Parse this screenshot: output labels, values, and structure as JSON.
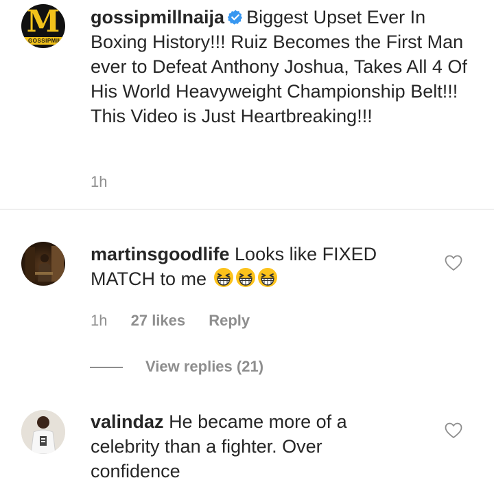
{
  "post": {
    "username": "gossipmillnaija",
    "avatar_text": "M",
    "avatar_band_text": "GOSSIPMILL",
    "caption": "Biggest Upset Ever In Boxing History!!! Ruiz Becomes the First Man ever to Defeat Anthony Joshua, Takes All 4 Of His World Heavyweight Championship Belt!!! This Video is Just Heartbreaking!!!",
    "time": "1h"
  },
  "comments": [
    {
      "username": "martinsgoodlife",
      "text": "Looks like FIXED MATCH to me",
      "emojis": [
        "grinning-squinting-face",
        "grinning-squinting-face",
        "grinning-squinting-face"
      ],
      "time": "1h",
      "likes": "27 likes",
      "reply_label": "Reply",
      "view_replies": "View replies (21)"
    },
    {
      "username": "valindaz",
      "text": "He became more of a celebrity than a fighter. Over confidence"
    }
  ],
  "colors": {
    "text": "#262626",
    "meta": "#8e8e8e",
    "verified": "#3897f0",
    "divider": "#dbdbdb",
    "brand_yellow": "#f2c21b"
  }
}
